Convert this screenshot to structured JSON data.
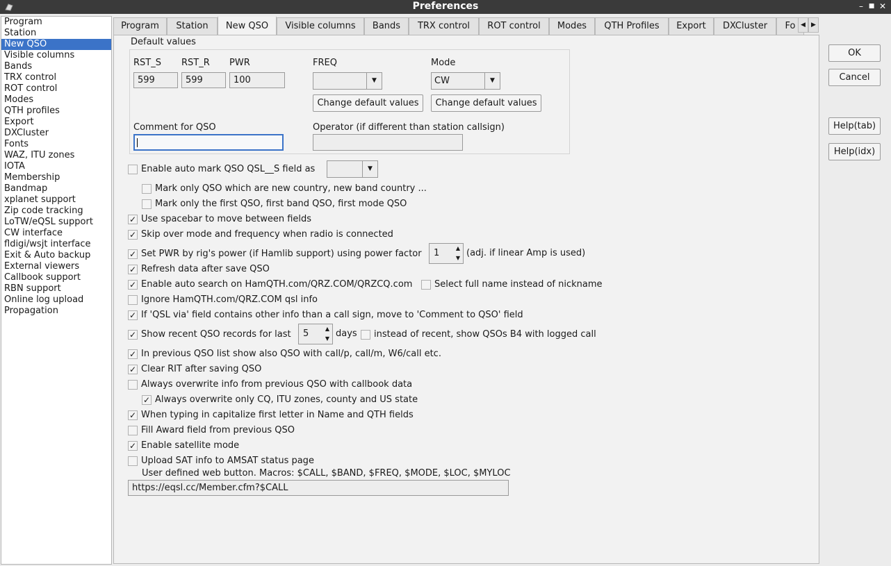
{
  "window": {
    "title": "Preferences",
    "minimize": "–",
    "maximize": "■",
    "close": "✕"
  },
  "sidebar": {
    "items": [
      {
        "label": "Program"
      },
      {
        "label": "Station"
      },
      {
        "label": "New QSO"
      },
      {
        "label": "Visible columns"
      },
      {
        "label": "Bands"
      },
      {
        "label": "TRX control"
      },
      {
        "label": "ROT control"
      },
      {
        "label": "Modes"
      },
      {
        "label": "QTH profiles"
      },
      {
        "label": "Export"
      },
      {
        "label": "DXCluster"
      },
      {
        "label": "Fonts"
      },
      {
        "label": "WAZ, ITU zones"
      },
      {
        "label": "IOTA"
      },
      {
        "label": "Membership"
      },
      {
        "label": "Bandmap"
      },
      {
        "label": "xplanet support"
      },
      {
        "label": "Zip code tracking"
      },
      {
        "label": "LoTW/eQSL support"
      },
      {
        "label": "CW interface"
      },
      {
        "label": "fldigi/wsjt interface"
      },
      {
        "label": "Exit & Auto backup"
      },
      {
        "label": "External viewers"
      },
      {
        "label": "Callbook support"
      },
      {
        "label": "RBN support"
      },
      {
        "label": "Online log upload"
      },
      {
        "label": "Propagation"
      }
    ],
    "selected": "New QSO"
  },
  "tabs": [
    {
      "label": "Program"
    },
    {
      "label": "Station"
    },
    {
      "label": "New QSO"
    },
    {
      "label": "Visible columns"
    },
    {
      "label": "Bands"
    },
    {
      "label": "TRX control"
    },
    {
      "label": "ROT control"
    },
    {
      "label": "Modes"
    },
    {
      "label": "QTH Profiles"
    },
    {
      "label": "Export"
    },
    {
      "label": "DXCluster"
    },
    {
      "label": "Fo"
    }
  ],
  "active_tab": "New QSO",
  "defaults": {
    "group_title": "Default values",
    "rst_s_label": "RST_S",
    "rst_s_value": "599",
    "rst_r_label": "RST_R",
    "rst_r_value": "599",
    "pwr_label": "PWR",
    "pwr_value": "100",
    "freq_label": "FREQ",
    "freq_value": "",
    "mode_label": "Mode",
    "mode_value": "CW",
    "change_freq_button": "Change default values",
    "change_mode_button": "Change default values",
    "comment_label": "Comment for QSO",
    "comment_value": "",
    "operator_label": "Operator (if different than station callsign)",
    "operator_value": ""
  },
  "options": {
    "auto_mark": {
      "label": "Enable auto mark QSO QSL__S field as",
      "checked": false,
      "combo_value": ""
    },
    "mark_new_country": {
      "label": "Mark only QSO which are new country, new band country ...",
      "checked": false
    },
    "mark_first": {
      "label": "Mark only the first QSO, first band QSO, first mode QSO",
      "checked": false
    },
    "spacebar": {
      "label": "Use spacebar to move between fields",
      "checked": true
    },
    "skip_mode": {
      "label": "Skip over mode and frequency when radio is connected",
      "checked": true
    },
    "set_pwr": {
      "label": "Set PWR by rig's power (if Hamlib support) using power factor",
      "checked": true,
      "value": "1",
      "suffix": "(adj. if linear Amp is used)"
    },
    "refresh": {
      "label": "Refresh data after save QSO",
      "checked": true
    },
    "auto_search": {
      "label": "Enable auto search on HamQTH.com/QRZ.COM/QRZCQ.com",
      "checked": true
    },
    "full_name": {
      "label": "Select full name instead of nickname",
      "checked": false
    },
    "ignore_qsl": {
      "label": "Ignore HamQTH.com/QRZ.COM qsl info",
      "checked": false
    },
    "qsl_via": {
      "label": "If 'QSL via' field contains other info than a call sign, move to 'Comment to QSO' field",
      "checked": true
    },
    "show_recent": {
      "label": "Show recent QSO records for last",
      "checked": true,
      "value": "5",
      "suffix": "days"
    },
    "instead_recent": {
      "label": "instead of recent, show QSOs B4 with logged call",
      "checked": false
    },
    "prev_list": {
      "label": "In previous QSO list show also QSO with call/p, call/m, W6/call etc.",
      "checked": true
    },
    "clear_rit": {
      "label": "Clear RIT after saving QSO",
      "checked": true
    },
    "overwrite": {
      "label": "Always overwrite info from previous QSO with callbook data",
      "checked": false
    },
    "overwrite_only": {
      "label": "Always overwrite only CQ, ITU zones, county and US state",
      "checked": true
    },
    "capitalize": {
      "label": "When typing in capitalize first letter in Name and QTH fields",
      "checked": true
    },
    "fill_award": {
      "label": "Fill Award field from previous QSO",
      "checked": false
    },
    "satellite": {
      "label": "Enable satellite mode",
      "checked": true
    },
    "upload_sat": {
      "label": "Upload SAT info to AMSAT status page",
      "checked": false
    }
  },
  "web_button": {
    "label": "User defined web button. Macros: $CALL, $BAND, $FREQ, $MODE, $LOC, $MYLOC",
    "value": "https://eqsl.cc/Member.cfm?$CALL"
  },
  "buttons": {
    "ok": "OK",
    "cancel": "Cancel",
    "help_tab": "Help(tab)",
    "help_idx": "Help(idx)"
  },
  "glyphs": {
    "check": "✓",
    "down": "▼",
    "up": "▲",
    "left": "◀",
    "right": "▶"
  }
}
